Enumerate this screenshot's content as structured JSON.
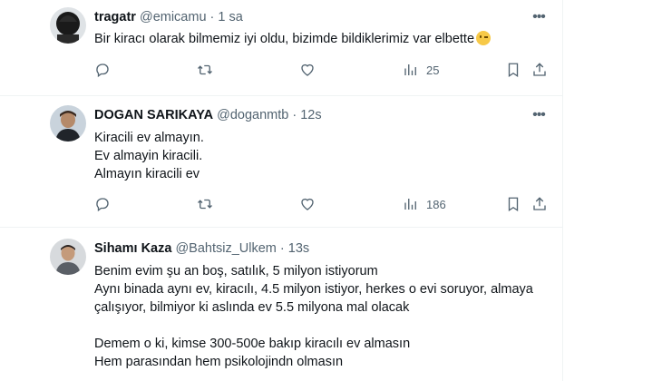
{
  "tweets": [
    {
      "name": "tragatr",
      "handle": "@emicamu",
      "separator": "·",
      "time": "1 sa",
      "lines": [
        "Bir kiracı olarak bilmemiz iyi oldu, bizimde bildiklerimiz var elbette"
      ],
      "emoji": "winking-face",
      "views": "25"
    },
    {
      "name": "DOGAN SARIKAYA",
      "handle": "@doganmtb",
      "separator": "·",
      "time": "12s",
      "lines": [
        "Kiracili ev almayın.",
        "Ev almayin kiracili.",
        "Almayın kiracili ev"
      ],
      "views": "186"
    },
    {
      "name": "Sihamı Kaza",
      "handle": "@Bahtsiz_Ulkem",
      "separator": "·",
      "time": "13s",
      "lines": [
        "Benim evim şu an boş, satılık, 5 milyon istiyorum",
        "Aynı binada aynı ev, kiracılı, 4.5 milyon istiyor, herkes o evi soruyor, almaya",
        "çalışıyor, bilmiyor ki aslında ev 5.5 milyona mal olacak",
        "",
        "Demem o ki, kimse 300-500e bakıp kiracılı ev almasın",
        "Hem parasından hem psikolojindn olmasın"
      ]
    }
  ],
  "icons": [
    "reply-icon",
    "retweet-icon",
    "like-icon",
    "views-icon",
    "bookmark-icon",
    "share-icon",
    "more-icon"
  ],
  "colors": {
    "text": "#0f1419",
    "secondary": "#536471",
    "divider": "#eff3f4"
  }
}
